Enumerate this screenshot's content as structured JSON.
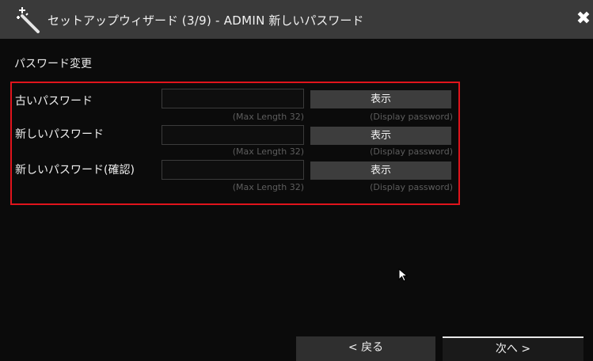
{
  "titlebar": {
    "icon": "magic-wand-icon",
    "title_jp": "セットアップウィザード",
    "title_step": "(3/9)",
    "title_sep": "- ADMIN",
    "title_sub": "新しいパスワード",
    "close_icon": "close-icon",
    "close_glyph": "✖"
  },
  "section": {
    "title": "パスワード変更"
  },
  "rows": [
    {
      "label": "古いパスワード",
      "value": "",
      "max_hint": "(Max Length 32)",
      "show_label": "表示",
      "show_hint": "(Display password)"
    },
    {
      "label": "新しいパスワード",
      "value": "",
      "max_hint": "(Max Length 32)",
      "show_label": "表示",
      "show_hint": "(Display password)"
    },
    {
      "label": "新しいパスワード(確認)",
      "value": "",
      "max_hint": "(Max Length 32)",
      "show_label": "表示",
      "show_hint": "(Display password)"
    }
  ],
  "footer": {
    "back_label": "< 戻る",
    "next_label": "次へ >"
  },
  "colors": {
    "highlight_border": "#e0141c",
    "titlebar_bg": "#3a3a3a",
    "button_bg": "#3d3d3d"
  }
}
